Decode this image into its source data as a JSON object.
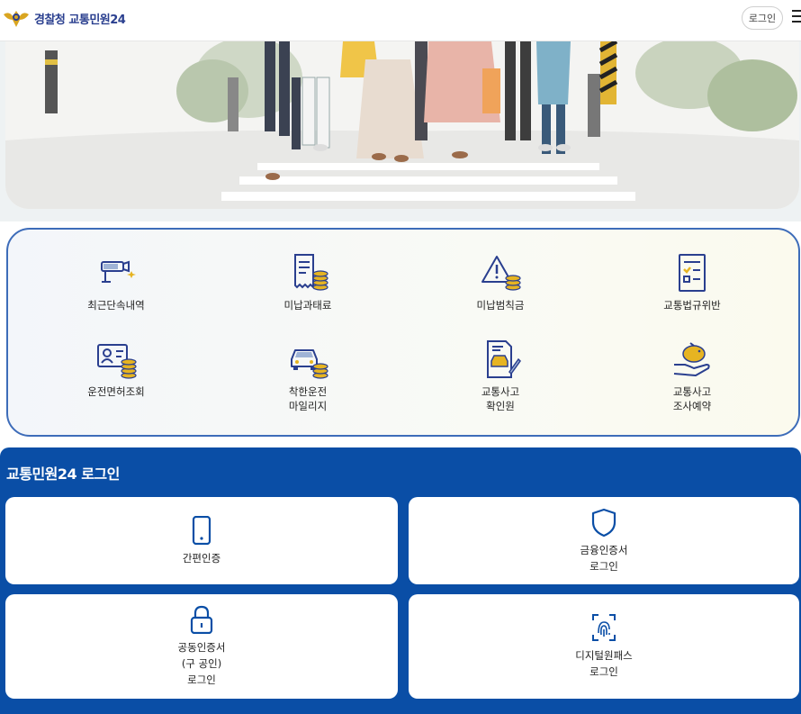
{
  "header": {
    "agency": "경찰청",
    "service": "교통민원24",
    "login_button": "로그인"
  },
  "services": [
    {
      "icon": "camera-icon",
      "label": "최근단속내역"
    },
    {
      "icon": "unpaid-fine-icon",
      "label": "미납과태료"
    },
    {
      "icon": "warning-coins-icon",
      "label": "미납범칙금"
    },
    {
      "icon": "traffic-law-doc-icon",
      "label": "교통법규위반"
    },
    {
      "icon": "license-card-icon",
      "label": "운전면허조회"
    },
    {
      "icon": "car-coins-icon",
      "label": "착한운전\n마일리지"
    },
    {
      "icon": "accident-doc-icon",
      "label": "교통사고\n확인원"
    },
    {
      "icon": "piggy-bank-icon",
      "label": "교통사고\n조사예약"
    }
  ],
  "login": {
    "title": "교통민원24 로그인",
    "options": [
      {
        "icon": "phone-icon",
        "label": "간편인증"
      },
      {
        "icon": "shield-icon",
        "label": "금융인증서\n로그인"
      },
      {
        "icon": "lock-icon",
        "label": "공동인증서\n(구 공인)\n로그인"
      },
      {
        "icon": "fingerprint-icon",
        "label": "디지털원패스\n로그인"
      }
    ]
  },
  "colors": {
    "brand_blue": "#0a4ea6",
    "navy": "#2a3f8f",
    "gold": "#e6b422",
    "panel_border": "#3d6cb9"
  }
}
